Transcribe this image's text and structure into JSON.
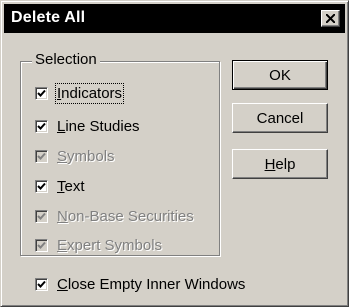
{
  "dialog": {
    "title": "Delete All",
    "close_glyph": "×"
  },
  "selection": {
    "label": "Selection",
    "items": [
      {
        "pre": "",
        "ul": "I",
        "post": "ndicators",
        "checked": true,
        "enabled": true
      },
      {
        "pre": "",
        "ul": "L",
        "post": "ine Studies",
        "checked": true,
        "enabled": true
      },
      {
        "pre": "",
        "ul": "S",
        "post": "ymbols",
        "checked": true,
        "enabled": false
      },
      {
        "pre": "",
        "ul": "T",
        "post": "ext",
        "checked": true,
        "enabled": true
      },
      {
        "pre": "",
        "ul": "N",
        "post": "on-Base Securities",
        "checked": true,
        "enabled": false
      },
      {
        "pre": "",
        "ul": "E",
        "post": "xpert Symbols",
        "checked": true,
        "enabled": false
      }
    ]
  },
  "close_empty": {
    "pre": "",
    "ul": "C",
    "post": "lose Empty Inner Windows",
    "checked": true
  },
  "buttons": {
    "ok": "OK",
    "cancel": "Cancel",
    "help_ul": "H",
    "help_rest": "elp"
  },
  "icons": {
    "close": "close-icon",
    "check": "checkmark-icon"
  }
}
